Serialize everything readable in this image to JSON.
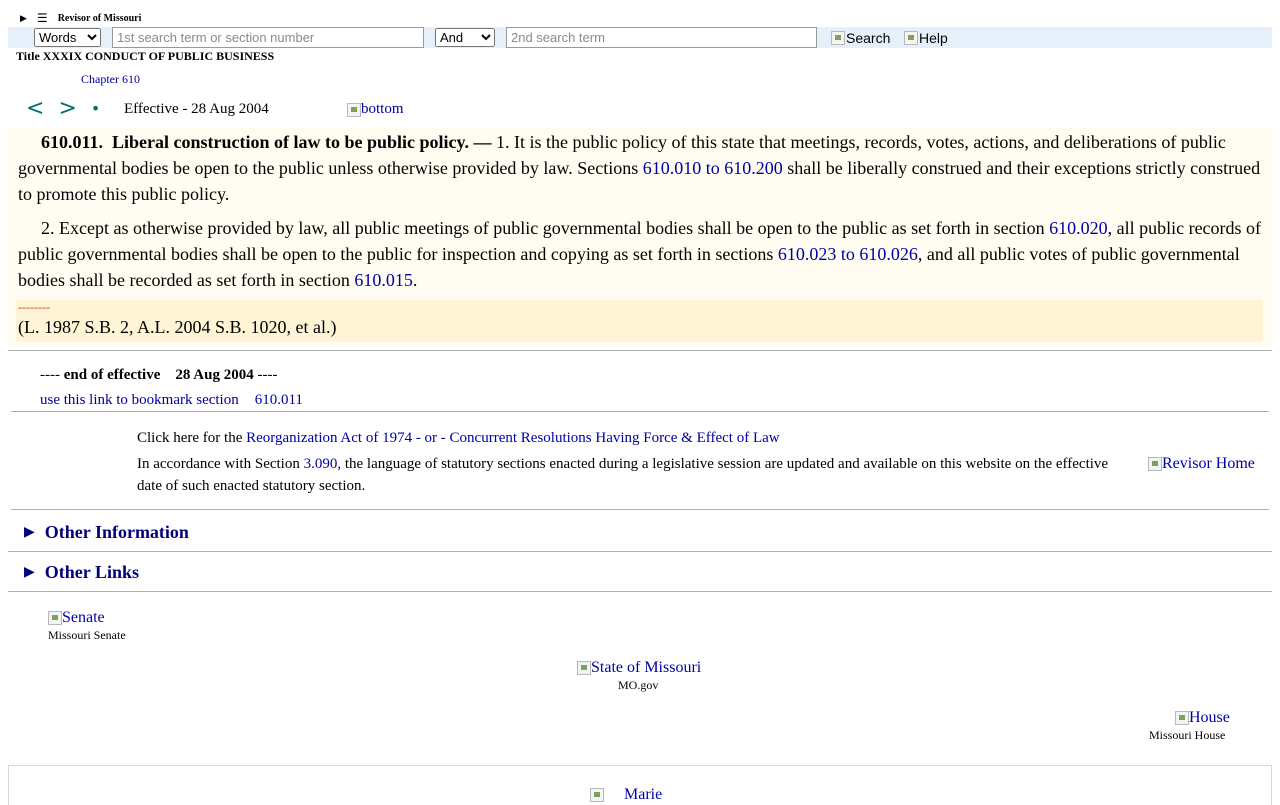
{
  "header": {
    "site_name": "Revisor of Missouri",
    "menu_glyph": "☰",
    "toggle_glyph": "▶"
  },
  "search": {
    "mode_options": [
      "Words"
    ],
    "mode_selected": "Words",
    "term1_placeholder": "1st search term or section number",
    "term1_value": "",
    "conjunction_selected": "And",
    "term2_placeholder": "2nd search term",
    "term2_value": "",
    "search_label": "Search",
    "help_label": "Help"
  },
  "breadcrumb": {
    "title": "Title XXXIX CONDUCT OF PUBLIC BUSINESS",
    "chapter": "Chapter 610"
  },
  "nav": {
    "prev": "<",
    "next": ">",
    "dot": "•",
    "effective": "Effective - 28 Aug 2004",
    "bottom_link": "bottom"
  },
  "statute": {
    "section": "610.011.",
    "heading": "Liberal construction of law to be public policy. —",
    "p1_a": " 1.  It is the public policy of this state that meetings, records, votes, actions, and deliberations of public governmental bodies be open to the public unless otherwise provided by law.  Sections ",
    "p1_link": "610.010 to 610.200",
    "p1_b": " shall be liberally construed and their exceptions strictly construed to promote this public policy.",
    "p2_a": "2.  Except as otherwise provided by law, all public meetings of public governmental bodies shall be open to the public as set forth in section ",
    "p2_link1": "610.020",
    "p2_b": ", all public records of public governmental bodies shall be open to the public for inspection and copying as set forth in sections ",
    "p2_link2": "610.023 to 610.026",
    "p2_c": ", and all public votes of public governmental bodies shall be recorded as set forth in section ",
    "p2_link3": "610.015",
    "p2_d": ".",
    "dashes": "--------",
    "history": "(L. 1987 S.B. 2, A.L. 2004 S.B. 1020, et al.)"
  },
  "end": {
    "prefix": "---- ",
    "label": "end of effective",
    "date": "28 Aug 2004",
    "suffix": " ----",
    "bookmark_text": "use this link to bookmark section",
    "bookmark_section": "610.011"
  },
  "notice": {
    "line1_a": "Click here for the ",
    "line1_link": "Reorganization Act of 1974 - or - Concurrent Resolutions Having Force & Effect of Law",
    "line2_a": "In accordance with Section ",
    "line2_link": "3.090",
    "line2_b": ", the language of statutory sections enacted during a legislative session are updated and available on this website on the effective date of such enacted statutory section.",
    "revisor_home": "Revisor Home"
  },
  "disclosures": {
    "other_information": "Other Information",
    "other_links": "Other Links",
    "toggle_glyph": "▶"
  },
  "footer": {
    "senate_alt": "Senate",
    "senate_caption": "Missouri Senate",
    "state_alt": "State of Missouri",
    "state_caption": "MO.gov",
    "house_alt": "House",
    "house_caption": "Missouri House",
    "marie_alt": "Marie"
  }
}
